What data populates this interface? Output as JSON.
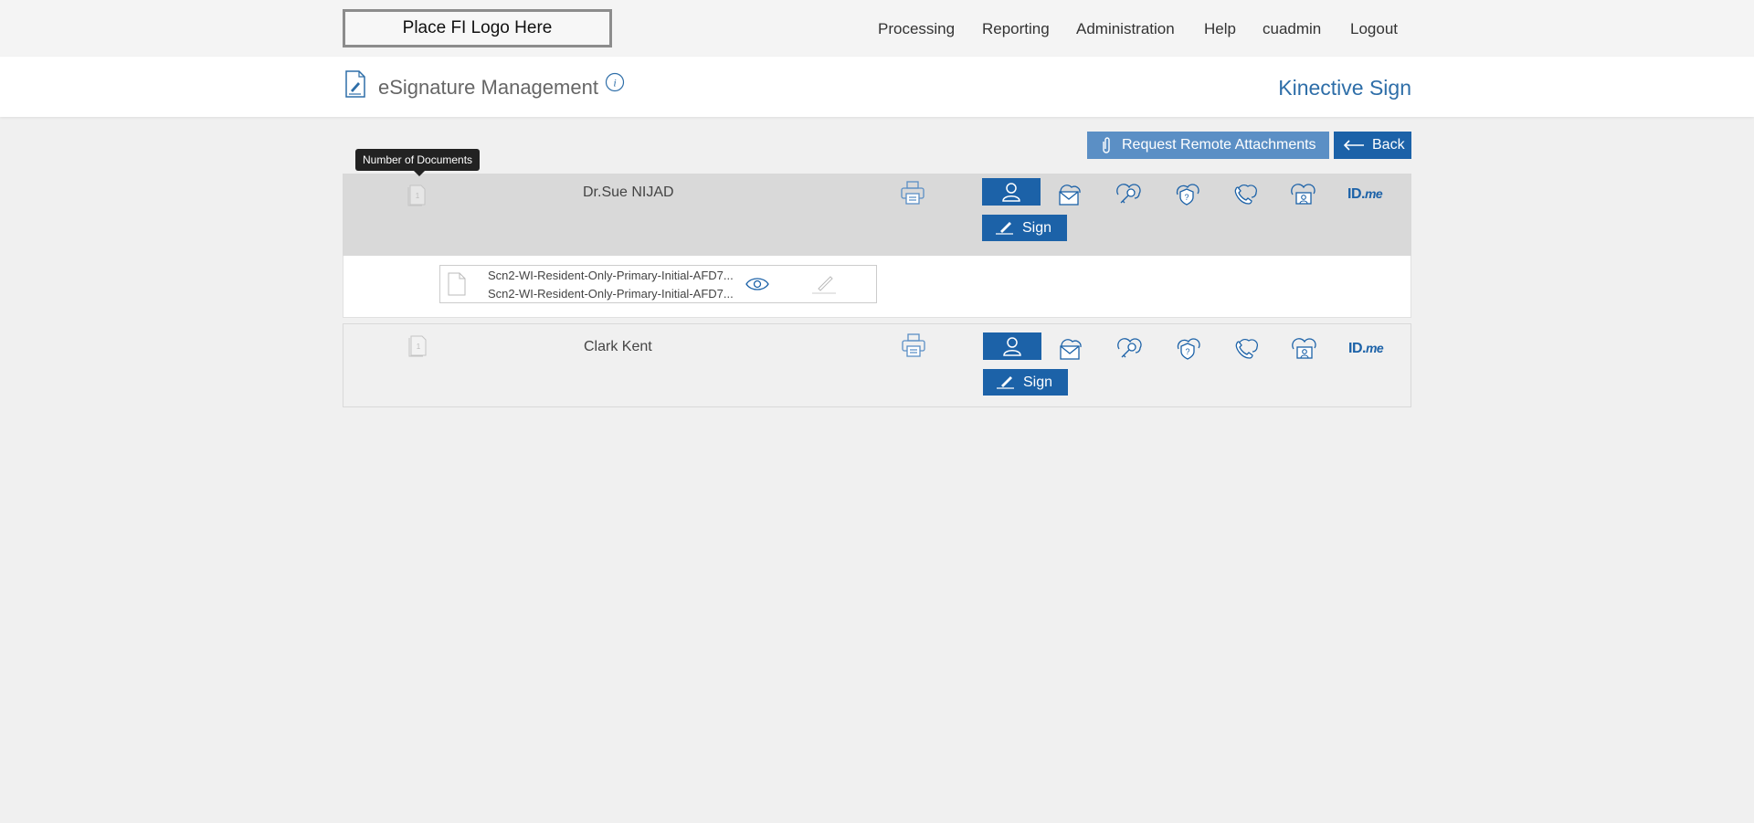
{
  "logo": {
    "text": "Place FI Logo Here"
  },
  "nav": {
    "items": [
      "Processing",
      "Reporting",
      "Administration",
      "Help",
      "cuadmin",
      "Logout"
    ]
  },
  "header": {
    "title": "eSignature Management",
    "brand": "Kinective Sign"
  },
  "actions": {
    "request_remote_attachments": "Request Remote Attachments",
    "back": "Back"
  },
  "tooltip": {
    "text": "Number of Documents"
  },
  "signers": [
    {
      "name": "Dr.Sue NIJAD",
      "doc_count": "1",
      "sign_label": "Sign",
      "documents": [
        {
          "line1": "Scn2-WI-Resident-Only-Primary-Initial-AFD7...",
          "line2": "Scn2-WI-Resident-Only-Primary-Initial-AFD7..."
        }
      ]
    },
    {
      "name": "Clark Kent",
      "doc_count": "1",
      "sign_label": "Sign"
    }
  ],
  "icons": {
    "auth_methods": [
      "in-person-icon",
      "email-icon",
      "password-key-icon",
      "security-question-icon",
      "phone-icon",
      "id-card-cloud-icon",
      "idme-logo"
    ],
    "idme_text": "ID.",
    "idme_suffix": "me"
  },
  "colors": {
    "primary": "#1c62a8",
    "secondary_button": "#5b8fc5",
    "brand_text": "#2e6ea8",
    "row_highlight": "#d9d9d9"
  }
}
